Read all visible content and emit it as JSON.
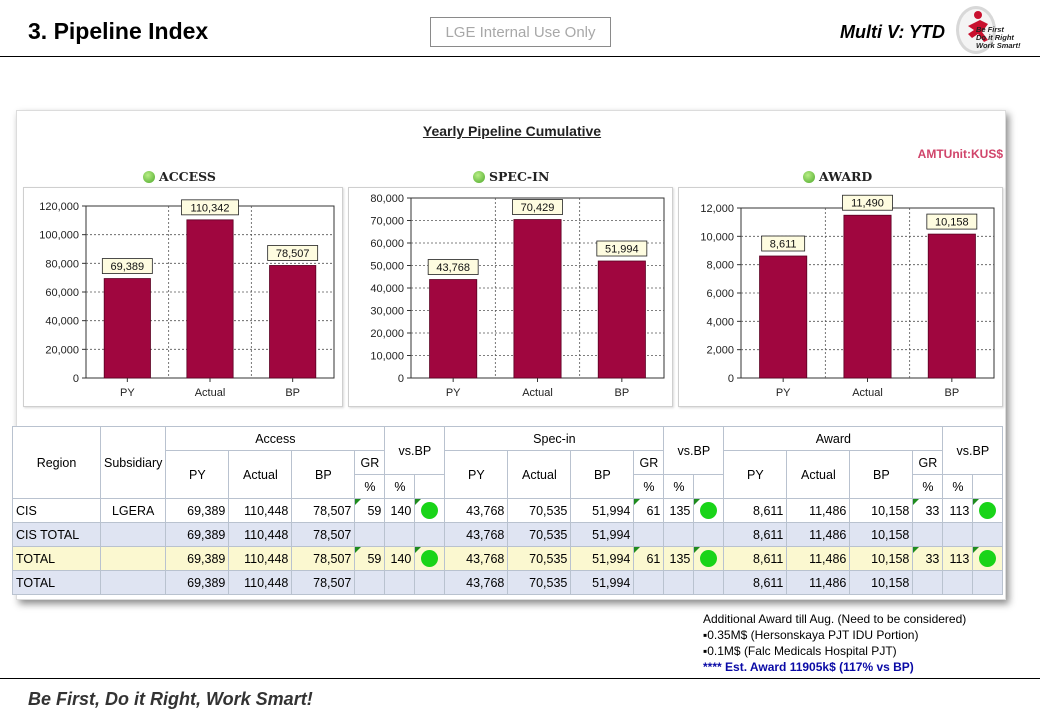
{
  "header": {
    "title": "3. Pipeline Index",
    "internal_label": "LGE Internal Use Only",
    "multiv_label": "Multi V: YTD",
    "logo_lines": [
      "Be First",
      "Do it Right",
      "Work Smart!"
    ]
  },
  "panel": {
    "title": "Yearly Pipeline Cumulative",
    "unit": "AMTUnit:KUS$"
  },
  "colors": {
    "bar": "#a0063f",
    "status_green": "#19d419",
    "unit_pink": "#d0446a",
    "note_blue": "#0a0aa6"
  },
  "chart_data": [
    {
      "type": "bar",
      "title": "ACCESS",
      "xlabel": "",
      "ylabel": "",
      "categories": [
        "PY",
        "Actual",
        "BP"
      ],
      "values": [
        69389,
        110342,
        78507
      ],
      "data_labels": [
        "69,389",
        "110,342",
        "78,507"
      ],
      "ylim": [
        0,
        120000
      ],
      "yticks": [
        0,
        20000,
        40000,
        60000,
        80000,
        100000,
        120000
      ],
      "ytick_labels": [
        "0",
        "20,000",
        "40,000",
        "60,000",
        "80,000",
        "100,000",
        "120,000"
      ],
      "grid": true
    },
    {
      "type": "bar",
      "title": "SPEC-IN",
      "xlabel": "",
      "ylabel": "",
      "categories": [
        "PY",
        "Actual",
        "BP"
      ],
      "values": [
        43768,
        70429,
        51994
      ],
      "data_labels": [
        "43,768",
        "70,429",
        "51,994"
      ],
      "ylim": [
        0,
        80000
      ],
      "yticks": [
        0,
        10000,
        20000,
        30000,
        40000,
        50000,
        60000,
        70000,
        80000
      ],
      "ytick_labels": [
        "0",
        "10,000",
        "20,000",
        "30,000",
        "40,000",
        "50,000",
        "60,000",
        "70,000",
        "80,000"
      ],
      "grid": true
    },
    {
      "type": "bar",
      "title": "AWARD",
      "xlabel": "",
      "ylabel": "",
      "categories": [
        "PY",
        "Actual",
        "BP"
      ],
      "values": [
        8611,
        11490,
        10158
      ],
      "data_labels": [
        "8,611",
        "11,490",
        "10,158"
      ],
      "ylim": [
        0,
        12000
      ],
      "yticks": [
        0,
        2000,
        4000,
        6000,
        8000,
        10000,
        12000
      ],
      "ytick_labels": [
        "0",
        "2,000",
        "4,000",
        "6,000",
        "8,000",
        "10,000",
        "12,000"
      ],
      "grid": true
    }
  ],
  "table": {
    "headers": {
      "region": "Region",
      "subsidiary": "Subsidiary",
      "access": "Access",
      "specin": "Spec-in",
      "award": "Award",
      "vsbp": "vs.BP",
      "py": "PY",
      "actual": "Actual",
      "bp": "BP",
      "gr": "GR",
      "pct": "%"
    },
    "rows": [
      {
        "region": "CIS",
        "subsidiary": "LGERA",
        "a_py": "69,389",
        "a_act": "110,448",
        "a_bp": "78,507",
        "a_gr": "59",
        "a_vs": "140",
        "s_py": "43,768",
        "s_act": "70,535",
        "s_bp": "51,994",
        "s_gr": "61",
        "s_vs": "135",
        "w_py": "8,611",
        "w_act": "11,486",
        "w_bp": "10,158",
        "w_gr": "33",
        "w_vs": "113"
      },
      {
        "region": "CIS TOTAL",
        "subsidiary": "",
        "a_py": "69,389",
        "a_act": "110,448",
        "a_bp": "78,507",
        "a_gr": "",
        "a_vs": "",
        "s_py": "43,768",
        "s_act": "70,535",
        "s_bp": "51,994",
        "s_gr": "",
        "s_vs": "",
        "w_py": "8,611",
        "w_act": "11,486",
        "w_bp": "10,158",
        "w_gr": "",
        "w_vs": ""
      },
      {
        "region": "TOTAL",
        "subsidiary": "",
        "a_py": "69,389",
        "a_act": "110,448",
        "a_bp": "78,507",
        "a_gr": "59",
        "a_vs": "140",
        "s_py": "43,768",
        "s_act": "70,535",
        "s_bp": "51,994",
        "s_gr": "61",
        "s_vs": "135",
        "w_py": "8,611",
        "w_act": "11,486",
        "w_bp": "10,158",
        "w_gr": "33",
        "w_vs": "113"
      },
      {
        "region": "TOTAL",
        "subsidiary": "",
        "a_py": "69,389",
        "a_act": "110,448",
        "a_bp": "78,507",
        "a_gr": "",
        "a_vs": "",
        "s_py": "43,768",
        "s_act": "70,535",
        "s_bp": "51,994",
        "s_gr": "",
        "s_vs": "",
        "w_py": "8,611",
        "w_act": "11,486",
        "w_bp": "10,158",
        "w_gr": "",
        "w_vs": ""
      }
    ]
  },
  "notes": {
    "line1": "Additional Award till Aug. (Need to be considered)",
    "line2": "▪0.35M$ (Hersonskaya PJT IDU Portion)",
    "line3": "▪0.1M$ (Falc Medicals Hospital PJT)",
    "line4": "**** Est. Award  11905k$  (117%  vs BP)"
  },
  "footer": {
    "slogan": "Be First, Do it Right, Work Smart!"
  }
}
